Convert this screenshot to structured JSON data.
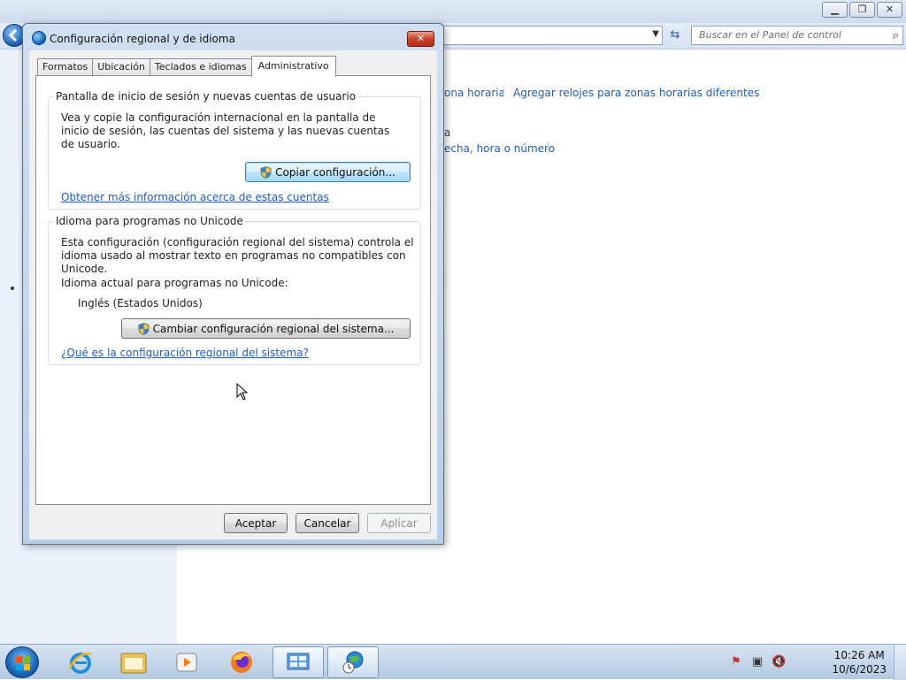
{
  "background": {
    "search_placeholder": "Buscar en el Panel de control",
    "links": {
      "zona_horaria": "ona horaria",
      "agregar_relojes": "Agregar relojes para zonas horarias diferentes",
      "a_fragment": "a",
      "fecha_hora": "echa, hora o número"
    }
  },
  "dialog": {
    "title": "Configuración regional y de idioma",
    "close_label": "✕",
    "tabs": [
      {
        "label": "Formatos"
      },
      {
        "label": "Ubicación"
      },
      {
        "label": "Teclados e idiomas"
      },
      {
        "label": "Administrativo"
      }
    ],
    "group_login": {
      "title": "Pantalla de inicio de sesión y nuevas cuentas de usuario",
      "description": "Vea y copie la configuración internacional en la pantalla de inicio de sesión, las cuentas del sistema y las nuevas cuentas de usuario.",
      "copy_button": "Copiar configuración...",
      "more_info_link": "Obtener más información acerca de estas cuentas"
    },
    "group_unicode": {
      "title": "Idioma para programas no Unicode",
      "description": "Esta configuración (configuración regional del sistema) controla el idioma usado al mostrar texto en programas no compatibles con Unicode.",
      "current_label": "Idioma actual para programas no Unicode:",
      "current_value": "Inglés (Estados Unidos)",
      "change_button": "Cambiar configuración regional del sistema...",
      "what_is_link": "¿Qué es la configuración regional del sistema?"
    },
    "buttons": {
      "ok": "Aceptar",
      "cancel": "Cancelar",
      "apply": "Aplicar"
    }
  },
  "taskbar": {
    "clock_time": "10:26 AM",
    "clock_date": "10/6/2023"
  }
}
